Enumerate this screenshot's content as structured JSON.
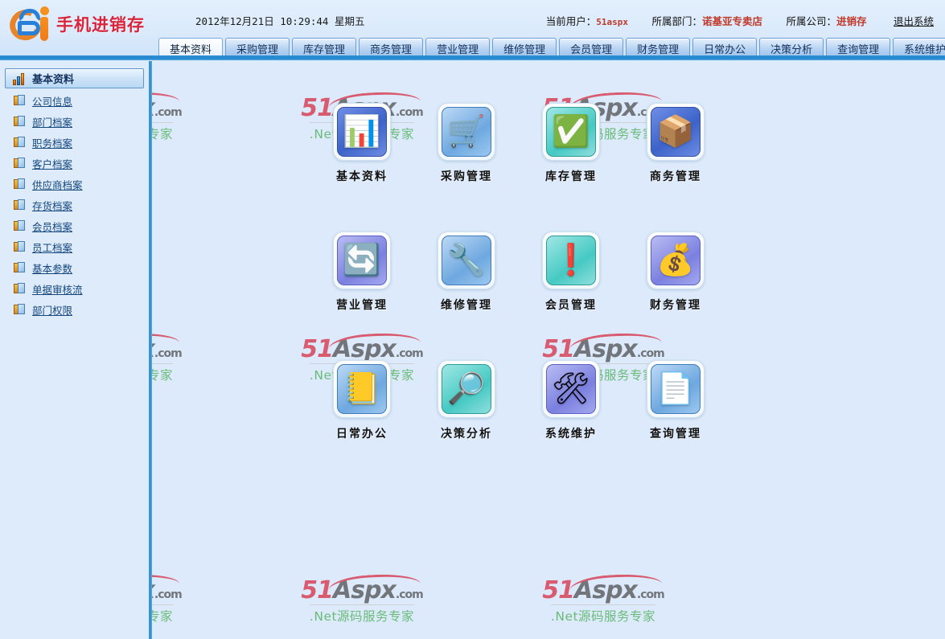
{
  "header": {
    "logo_text": "手机进销存",
    "logo_icon": "b-swirl-logo-icon",
    "datetime": "2012年12月21日  10:29:44  星期五",
    "user_label": "当前用户：",
    "user_value": "51aspx",
    "dept_label": "所属部门：",
    "dept_value": "诺基亚专卖店",
    "company_label": "所属公司：",
    "company_value": "进销存",
    "logout_label": "退出系统"
  },
  "tabs": [
    {
      "label": "基本资料",
      "active": true
    },
    {
      "label": "采购管理",
      "active": false
    },
    {
      "label": "库存管理",
      "active": false
    },
    {
      "label": "商务管理",
      "active": false
    },
    {
      "label": "营业管理",
      "active": false
    },
    {
      "label": "维修管理",
      "active": false
    },
    {
      "label": "会员管理",
      "active": false
    },
    {
      "label": "财务管理",
      "active": false
    },
    {
      "label": "日常办公",
      "active": false
    },
    {
      "label": "决策分析",
      "active": false
    },
    {
      "label": "查询管理",
      "active": false
    },
    {
      "label": "系统维护",
      "active": false
    }
  ],
  "sidebar": {
    "title": "基本资料",
    "title_icon": "bar-chart-up-icon",
    "items": [
      {
        "label": "公司信息",
        "icon": "module-icon"
      },
      {
        "label": "部门档案",
        "icon": "module-icon"
      },
      {
        "label": "职务档案",
        "icon": "module-icon"
      },
      {
        "label": "客户档案",
        "icon": "module-icon"
      },
      {
        "label": "供应商档案",
        "icon": "module-icon"
      },
      {
        "label": "存货档案",
        "icon": "module-icon"
      },
      {
        "label": "会员档案",
        "icon": "module-icon"
      },
      {
        "label": "员工档案",
        "icon": "module-icon"
      },
      {
        "label": "基本参数",
        "icon": "module-icon"
      },
      {
        "label": "单据审核流",
        "icon": "module-icon"
      },
      {
        "label": "部门权限",
        "icon": "module-icon"
      }
    ]
  },
  "modules": [
    {
      "label": "基本资料",
      "icon": "bar-chart-blinds-icon",
      "glyph": "📊",
      "tile": "bg-blue"
    },
    {
      "label": "采购管理",
      "icon": "shopping-cart-icon",
      "glyph": "🛒",
      "tile": "bg-lblue"
    },
    {
      "label": "库存管理",
      "icon": "inventory-checkmark-icon",
      "glyph": "✅",
      "tile": "bg-cyan"
    },
    {
      "label": "商务管理",
      "icon": "boxes-approved-icon",
      "glyph": "📦",
      "tile": "bg-blue"
    },
    {
      "label": "营业管理",
      "icon": "recycle-arrows-icon",
      "glyph": "🔄",
      "tile": "bg-violet"
    },
    {
      "label": "维修管理",
      "icon": "wrench-screen-icon",
      "glyph": "🔧",
      "tile": "bg-lblue"
    },
    {
      "label": "会员管理",
      "icon": "member-alert-icon",
      "glyph": "❗",
      "tile": "bg-cyan"
    },
    {
      "label": "财务管理",
      "icon": "money-bag-coins-icon",
      "glyph": "💰",
      "tile": "bg-violet"
    },
    {
      "label": "日常办公",
      "icon": "notebook-arrow-icon",
      "glyph": "📒",
      "tile": "bg-lblue"
    },
    {
      "label": "决策分析",
      "icon": "chart-magnifier-icon",
      "glyph": "🔎",
      "tile": "bg-cyan"
    },
    {
      "label": "系统维护",
      "icon": "wrench-screwdriver-icon",
      "glyph": "🛠",
      "tile": "bg-violet"
    },
    {
      "label": "查询管理",
      "icon": "document-magnifier-icon",
      "glyph": "📄",
      "tile": "bg-lblue"
    }
  ],
  "watermark": {
    "part_51": "51",
    "part_aspx": "Aspx",
    "part_com": ".com",
    "subtitle": ".Net源码服务专家"
  },
  "colors": {
    "accent_blue": "#2e8ccd",
    "page_bg": "#dceafb",
    "brand_red": "#d8253c",
    "watermark_green": "#3faa46",
    "value_red": "#c0392b"
  }
}
